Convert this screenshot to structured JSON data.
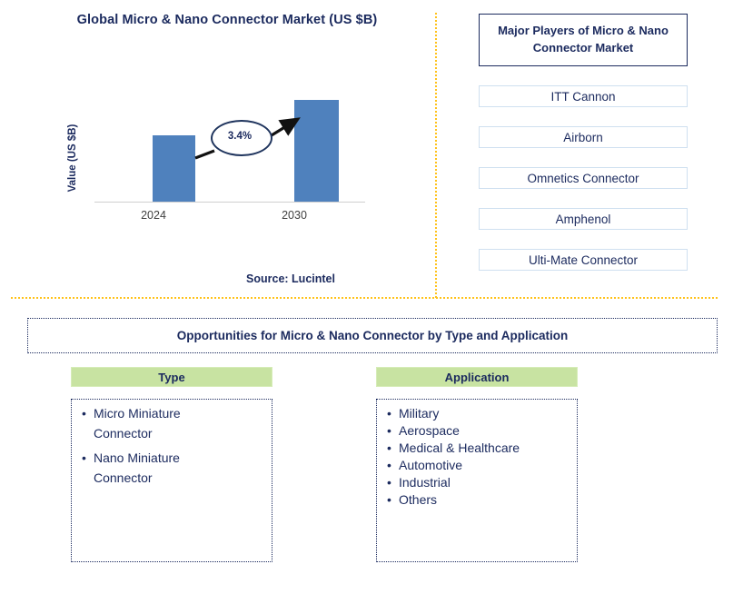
{
  "chart_title": "Global Micro & Nano Connector Market (US $B)",
  "source_note": "Source: Lucintel",
  "colors": {
    "bar": "#4F81BD",
    "navy_text": "#1B2A5E",
    "divider_gold": "#FFC21A",
    "header_green": "#C8E3A2",
    "player_border": "#CFE0F0"
  },
  "chart_data": {
    "type": "bar",
    "title": "Global Micro & Nano Connector Market (US $B)",
    "xlabel": "",
    "ylabel": "Value (US $B)",
    "categories": [
      "2024",
      "2030"
    ],
    "values": [
      57,
      87
    ],
    "value_unit": "relative bar height (no axis values labeled)",
    "annotations": [
      {
        "label": "3.4%",
        "meaning": "CAGR from 2024 to 2030",
        "from_category": "2024",
        "to_category": "2030",
        "shape": "ellipse-callout-with-arrow"
      }
    ],
    "grid": false,
    "legend": false,
    "tick_labels": [
      "2024",
      "2030"
    ],
    "series": [
      {
        "name": "Value (US $B)",
        "values": [
          57,
          87
        ]
      }
    ]
  },
  "players": {
    "header": "Major Players of Micro & Nano Connector Market",
    "items": [
      "ITT Cannon",
      "Airborn",
      "Omnetics Connector",
      "Amphenol",
      "Ulti-Mate Connector"
    ]
  },
  "opportunities": {
    "banner": "Opportunities for Micro & Nano Connector by Type and Application",
    "type": {
      "header": "Type",
      "items": [
        {
          "line1": "Micro Miniature",
          "line2": "Connector"
        },
        {
          "line1": "Nano Miniature",
          "line2": "Connector"
        }
      ]
    },
    "application": {
      "header": "Application",
      "items": [
        "Military",
        "Aerospace",
        "Medical & Healthcare",
        "Automotive",
        "Industrial",
        "Others"
      ]
    }
  }
}
